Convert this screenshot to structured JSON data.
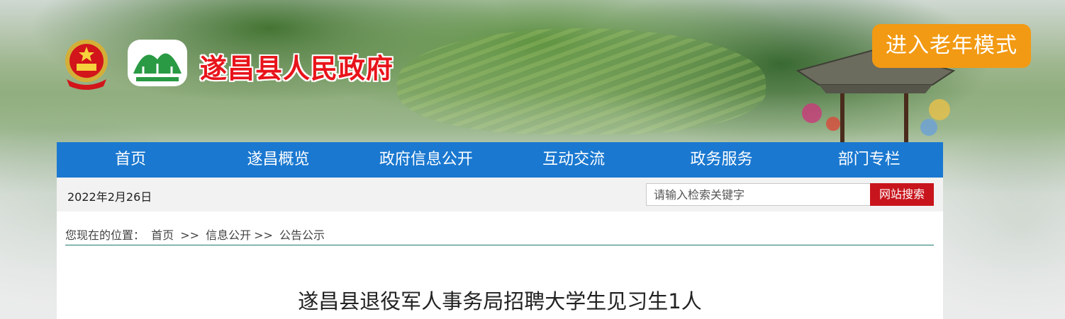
{
  "header": {
    "site_title": "遂昌县人民政府",
    "elder_mode_label": "进入老年模式"
  },
  "nav": {
    "items": [
      {
        "label": "首页"
      },
      {
        "label": "遂昌概览"
      },
      {
        "label": "政府信息公开"
      },
      {
        "label": "互动交流"
      },
      {
        "label": "政务服务"
      },
      {
        "label": "部门专栏"
      }
    ]
  },
  "topbar": {
    "date": "2022年2月26日",
    "search_placeholder": "请输入检索关键字",
    "search_button": "网站搜索"
  },
  "breadcrumb": {
    "prefix": "您现在的位置：",
    "home": "首页",
    "sep1": ">>",
    "info": "信息公开",
    "sep2": ">>",
    "current": "公告公示"
  },
  "article": {
    "title": "遂昌县退役军人事务局招聘大学生见习生1人"
  },
  "colors": {
    "nav_blue": "#1a78d0",
    "elder_orange": "#f29a13",
    "search_red": "#c8151d",
    "title_red": "#e8141b"
  }
}
